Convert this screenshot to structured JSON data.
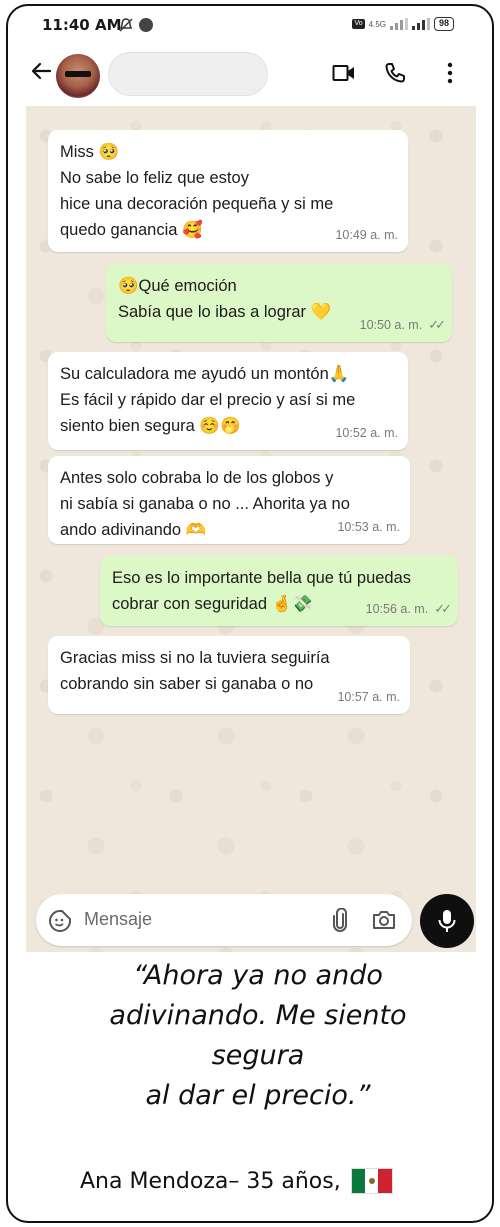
{
  "status_bar": {
    "time": "11:40 AM",
    "network": "4.5G",
    "battery": "98"
  },
  "header": {
    "contact_name": ""
  },
  "messages": [
    {
      "direction": "in",
      "text": "Miss 🥺\nNo sabe lo feliz que estoy\nhice una decoración pequeña y si me\nquedo ganancia 🥰",
      "time": "10:49 a. m."
    },
    {
      "direction": "out",
      "text": "🥺Qué emoción\nSabía que lo ibas a lograr 💛",
      "time": "10:50 a. m."
    },
    {
      "direction": "in",
      "text": "Su calculadora me ayudó un montón🙏\nEs fácil y rápido dar el precio y así si me\nsiento bien segura ☺️🤭",
      "time": "10:52 a. m."
    },
    {
      "direction": "in",
      "text": "Antes solo cobraba lo de los globos y\nni sabía si ganaba o no ... Ahorita ya no\nando adivinando 🫶",
      "time": "10:53 a. m."
    },
    {
      "direction": "out",
      "text": "Eso es lo importante bella que tú puedas\ncobrar con seguridad 🤞💸",
      "time": "10:56 a. m."
    },
    {
      "direction": "in",
      "text": "Gracias miss si no la tuviera seguiría\ncobrando sin saber si ganaba o no",
      "time": "10:57 a. m."
    }
  ],
  "input": {
    "placeholder": "Mensaje"
  },
  "testimonial": {
    "quote": "“Ahora ya no ando\nadivinando. Me siento\nsegura\nal dar el precio.”",
    "author": "Ana Mendoza– 35 años,"
  },
  "colors": {
    "incoming_bubble": "#ffffff",
    "outgoing_bubble": "#dcf8c6",
    "chat_background": "#efe7dc",
    "mic_button": "#0f0f0f"
  },
  "icons": {
    "back": "arrow-left-icon",
    "video": "video-camera-icon",
    "call": "phone-icon",
    "menu": "more-vertical-icon",
    "sticker": "sticker-icon",
    "attach": "paperclip-icon",
    "camera": "camera-icon",
    "mic": "microphone-icon",
    "flag": "mexico-flag-icon"
  }
}
